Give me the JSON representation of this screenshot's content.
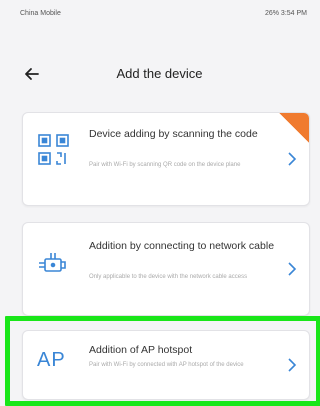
{
  "status_bar": {
    "carrier": "China Mobile",
    "right_info": "26% 3:54 PM"
  },
  "header": {
    "title": "Add the device"
  },
  "options": [
    {
      "title": "Device adding by scanning the code",
      "description": "Pair with Wi-Fi by scanning QR code on the device plane",
      "icon": "qr-scan-icon",
      "badge": true
    },
    {
      "title": "Addition by connecting to network cable",
      "description": "Only applicable to the device with the network cable access",
      "icon": "network-cable-icon",
      "badge": false
    },
    {
      "title": "Addition of AP hotspot",
      "description": "Pair with Wi-Fi by connected with AP hotspot of the device",
      "icon_text": "AP",
      "icon": "ap-hotspot-icon",
      "badge": false
    }
  ],
  "colors": {
    "accent": "#3a86d6",
    "badge": "#f07b2f",
    "highlight": "#19e619",
    "background": "#f4f4f6"
  }
}
